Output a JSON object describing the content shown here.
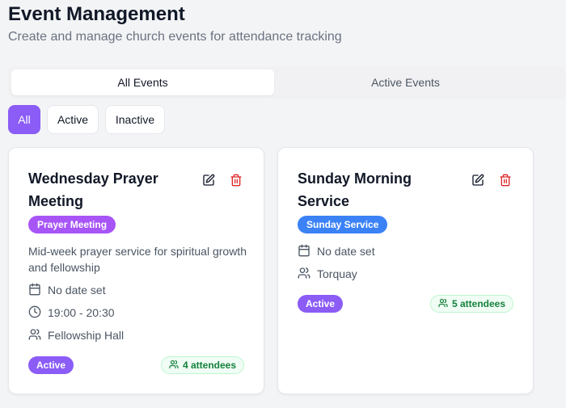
{
  "header": {
    "title": "Event Management",
    "subtitle": "Create and manage church events for attendance tracking"
  },
  "tabs": [
    {
      "label": "All Events",
      "active": true
    },
    {
      "label": "Active Events",
      "active": false
    }
  ],
  "filters": [
    {
      "label": "All",
      "active": true
    },
    {
      "label": "Active",
      "active": false
    },
    {
      "label": "Inactive",
      "active": false
    }
  ],
  "events": [
    {
      "title": "Wednesday Prayer Meeting",
      "category": "Prayer Meeting",
      "category_color": "#a855f7",
      "description": "Mid-week prayer service for spiritual growth and fellowship",
      "date": "No date set",
      "time": "19:00 - 20:30",
      "location": "Fellowship Hall",
      "status": "Active",
      "attendees": "4 attendees"
    },
    {
      "title": "Sunday Morning Service",
      "category": "Sunday Service",
      "category_color": "#3b82f6",
      "date": "No date set",
      "location": "Torquay",
      "status": "Active",
      "attendees": "5 attendees"
    }
  ],
  "colors": {
    "accent": "#8b5cf6",
    "delete": "#dc2626",
    "attendee_green": "#15803d"
  },
  "icons": {
    "edit": "pencil-square-icon",
    "delete": "trash-icon",
    "date": "calendar-icon",
    "time": "clock-icon",
    "location": "users-icon",
    "attendees": "users-icon"
  }
}
